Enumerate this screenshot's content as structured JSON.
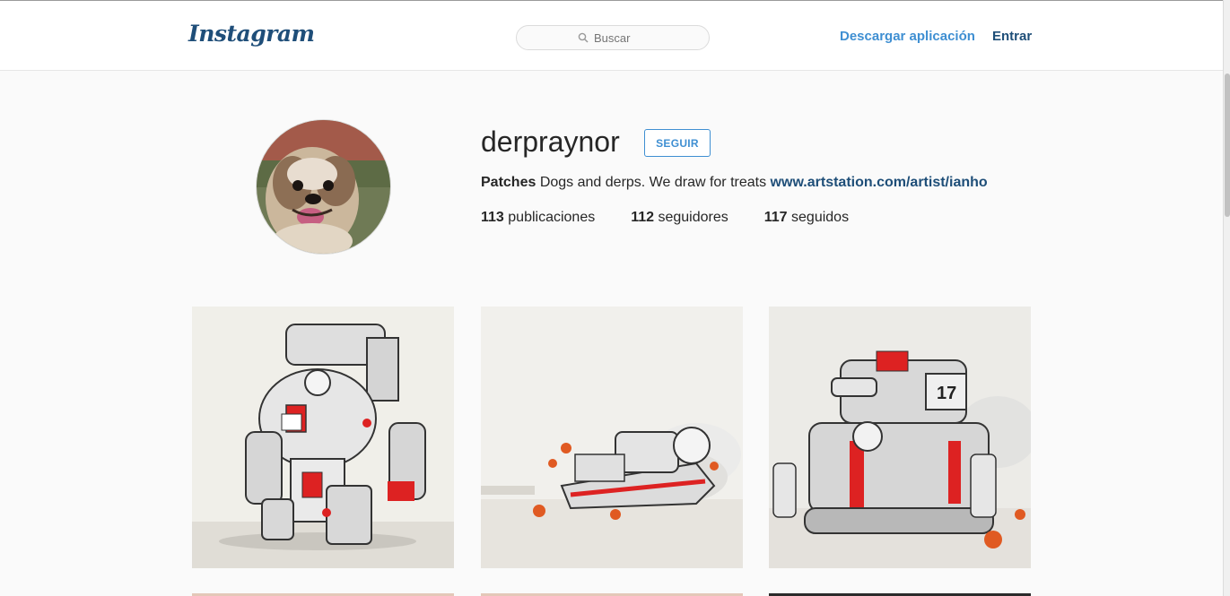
{
  "nav": {
    "logo": "Instagram",
    "search_placeholder": "Buscar",
    "download_label": "Descargar aplicación",
    "login_label": "Entrar"
  },
  "profile": {
    "username": "derpraynor",
    "follow_label": "SEGUIR",
    "bio_name": "Patches",
    "bio_text": "Dogs and derps. We draw for treats",
    "bio_link": "www.artstation.com/artist/ianho",
    "stats": [
      {
        "value": "113",
        "label": "publicaciones"
      },
      {
        "value": "112",
        "label": "seguidores"
      },
      {
        "value": "117",
        "label": "seguidos"
      }
    ]
  },
  "colors": {
    "accent_blue": "#3f8fd2",
    "dark_blue": "#1e4e78",
    "page_bg": "#fafafa"
  },
  "icons": [
    "search-icon"
  ]
}
